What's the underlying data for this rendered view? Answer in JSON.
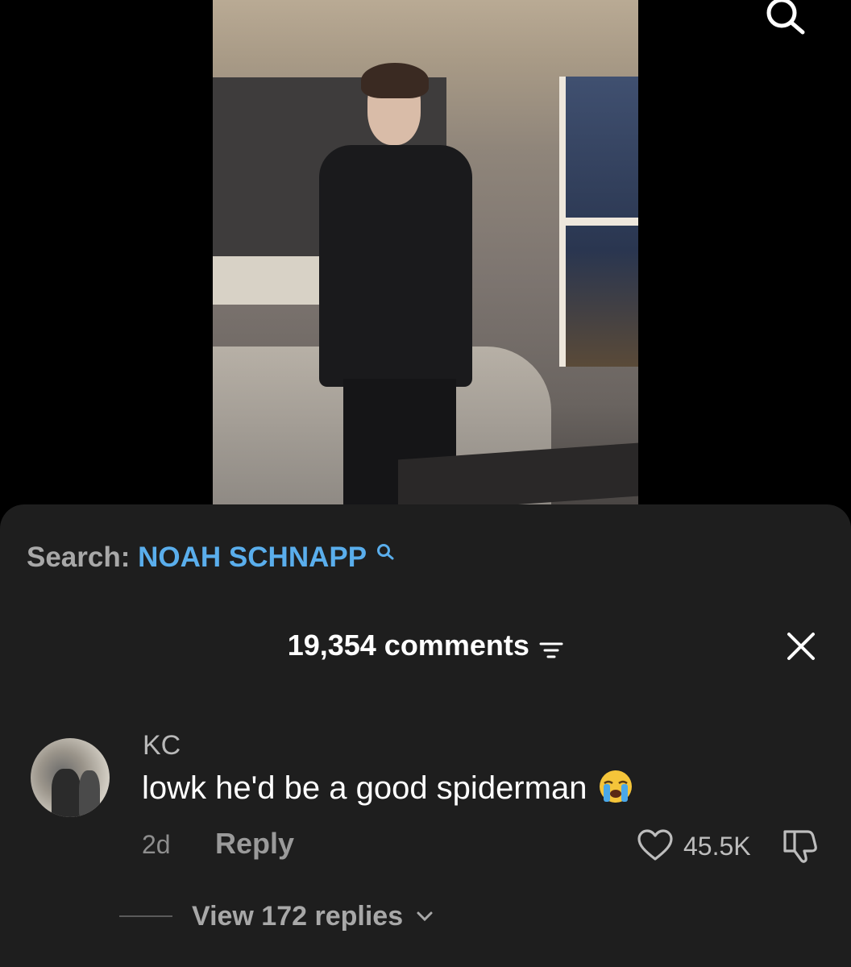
{
  "header": {
    "search_icon": "search-icon"
  },
  "video": {
    "description_visible": false
  },
  "search_suggestion": {
    "prefix": "Search:",
    "term": "NOAH SCHNAPP",
    "icon": "search-icon",
    "prefix_color": "#a8a8a8",
    "term_color": "#5aaeec"
  },
  "comments_panel": {
    "count_label": "19,354 comments",
    "filter_icon": "filter-icon",
    "close_icon": "close-icon",
    "background": "#1e1e1e"
  },
  "comments": [
    {
      "username": "KC",
      "text": "lowk he'd be a good spiderman",
      "emoji": "loudly-crying-face",
      "time": "2d",
      "reply_label": "Reply",
      "likes": "45.5K",
      "like_icon": "heart-icon",
      "dislike_icon": "thumbs-down-icon",
      "view_replies_label": "View 172 replies"
    }
  ]
}
